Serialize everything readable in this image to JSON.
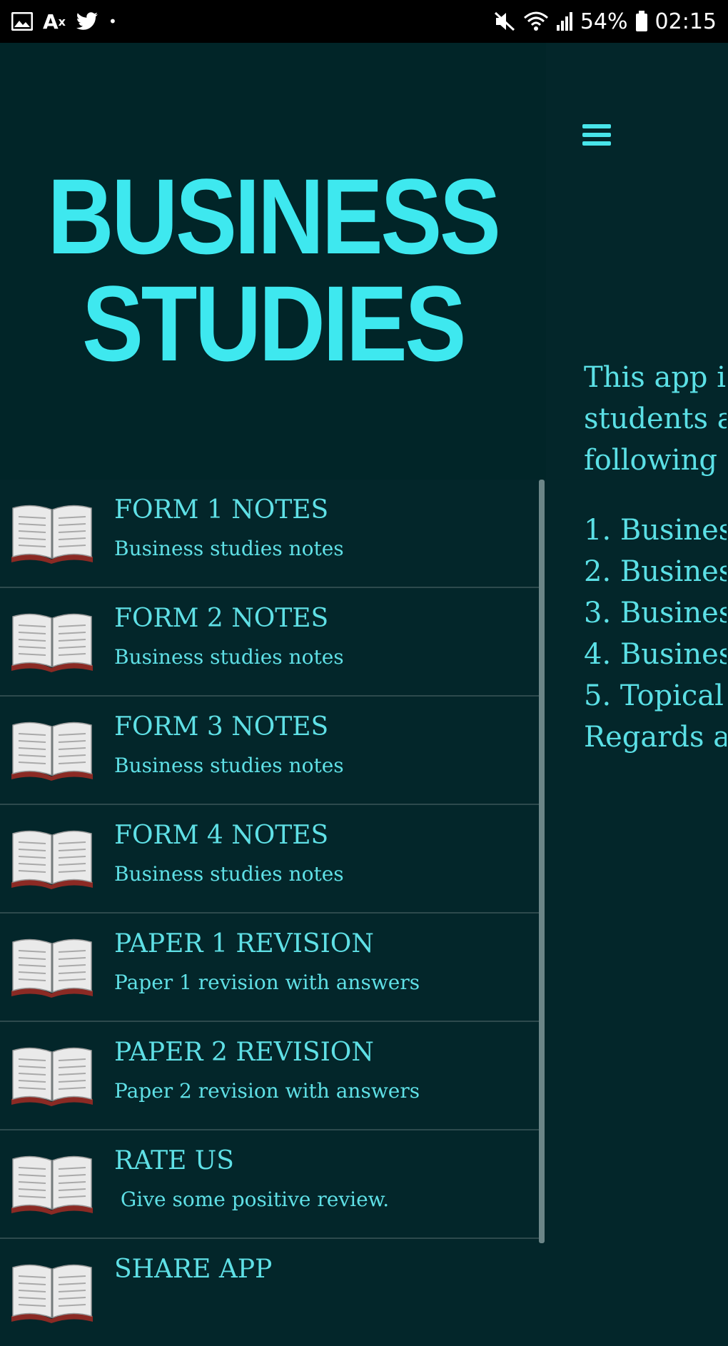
{
  "status_bar": {
    "battery": "54%",
    "time": "02:15",
    "icons_left": [
      "image-icon",
      "translate-icon",
      "twitter-icon",
      "dot-icon"
    ],
    "icons_right": [
      "mute-icon",
      "wifi-icon",
      "signal-icon",
      "battery-icon"
    ]
  },
  "main": {
    "intro_lines": [
      "This app i",
      "students a",
      "following"
    ],
    "list": [
      "1. Busines",
      "2. Busines",
      "3. Busines",
      "4. Busines",
      "5. Topical"
    ],
    "regards": "Regards a"
  },
  "drawer": {
    "title_line1": "BUSINESS",
    "title_line2": "STUDIES",
    "items": [
      {
        "label": "FORM 1 NOTES",
        "sub": "Business studies notes"
      },
      {
        "label": "FORM 2 NOTES",
        "sub": "Business studies notes"
      },
      {
        "label": "FORM 3 NOTES",
        "sub": "Business studies notes"
      },
      {
        "label": "FORM 4 NOTES",
        "sub": "Business studies notes"
      },
      {
        "label": "PAPER 1 REVISION",
        "sub": "Paper 1 revision with answers"
      },
      {
        "label": "PAPER 2 REVISION",
        "sub": "Paper 2 revision with answers"
      },
      {
        "label": "RATE US",
        "sub": " Give some positive review."
      },
      {
        "label": "SHARE APP",
        "sub": ""
      }
    ]
  },
  "colors": {
    "background": "#03262a",
    "header": "#012528",
    "accent": "#3ee8ef",
    "text": "#5fe0e6",
    "divider": "#2d4a4d"
  }
}
